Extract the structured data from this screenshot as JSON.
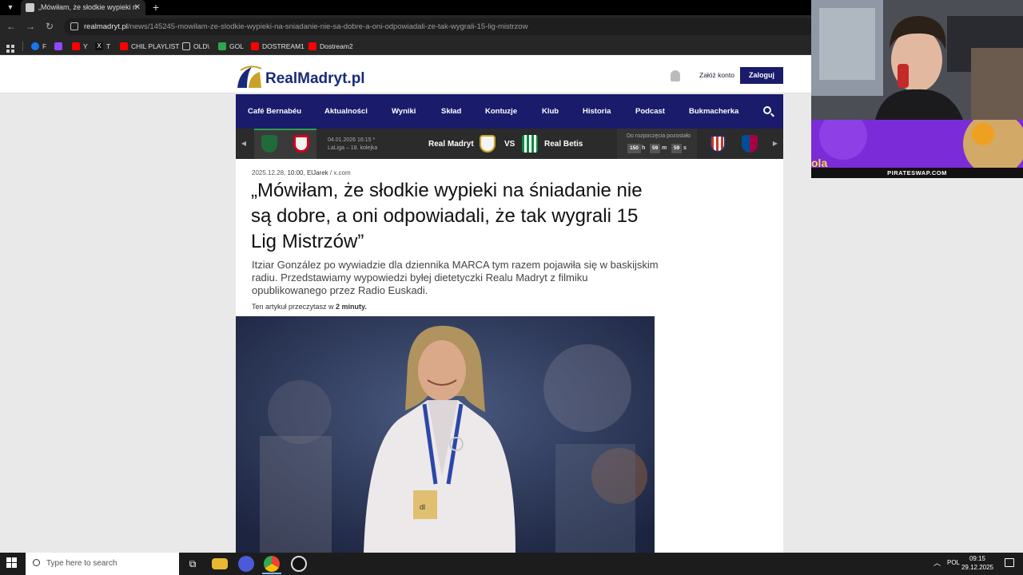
{
  "browser": {
    "tab_title": "„Mówiłam, że słodkie wypieki n",
    "tab_close": "✕",
    "new_tab": "+",
    "url_host": "realmadryt.pl",
    "url_path": "/news/145245-mowilam-ze-slodkie-wypieki-na-sniadanie-nie-sa-dobre-a-oni-odpowiadali-ze-tak-wygrali-15-lig-mistrzow",
    "bookmarks": [
      {
        "label": "F",
        "color": "#1877f2"
      },
      {
        "label": "",
        "color": "#9146ff"
      },
      {
        "label": "Y",
        "color": "#ff0000"
      },
      {
        "label": "T",
        "color": "#000000"
      },
      {
        "label": "CHIL PLAYLIST",
        "color": "#ff0000"
      },
      {
        "label": "OLD\\",
        "color": "#888888"
      },
      {
        "label": "GOL",
        "color": "#2aa84a"
      },
      {
        "label": "DOSTREAM1",
        "color": "#ff0000"
      },
      {
        "label": "Dostream2",
        "color": "#ff0000"
      }
    ]
  },
  "site": {
    "logo_main": "RealMadryt",
    "logo_tld": ".pl",
    "register_label": "Załóż konto",
    "login_label": "Zaloguj",
    "nav": [
      "Café Bernabéu",
      "Aktualności",
      "Wyniki",
      "Skład",
      "Kontuzje",
      "Klub",
      "Historia",
      "Podcast",
      "Bukmacherka"
    ]
  },
  "matchbar": {
    "prev_date": "04.01.2026 16:15 *",
    "prev_competition": "LaLiga – 18. kolejka",
    "home_team": "Real Madryt",
    "vs": "VS",
    "away_team": "Real Betis",
    "countdown_label": "Do rozpoczęcia pozostało",
    "countdown": {
      "hours": "150",
      "h": "h",
      "minutes": "59",
      "m": "m",
      "seconds": "59",
      "s": "s"
    }
  },
  "article": {
    "date": "2025.12.28, ",
    "time": "10:00",
    "sep": ", ",
    "author": "ElJarek",
    "source": " / x.com",
    "headline": "„Mówiłam, że słodkie wypieki na śniadanie nie są dobre, a oni odpowiadali, że tak wygrali 15 Lig Mistrzów”",
    "lead": "Itziar González po wywiadzie dla dziennika MARCA tym razem pojawiła się w baskijskim radiu. Przedstawiamy wypowiedzi byłej dietetyczki Realu Madryt z filmiku opublikowanego przez Radio Euskadi.",
    "read_prefix": "Ten artykuł przeczytasz w ",
    "read_time": "2 minuty."
  },
  "overlay": {
    "promo_text": "PIRATESWAP.COM",
    "promo_big": "ola"
  },
  "taskbar": {
    "search_placeholder": "Type here to search",
    "lang": "POL",
    "time": "09:15",
    "date": "29.12.2025"
  },
  "colors": {
    "brand_navy": "#1a1b6b",
    "accent_green": "#2e9e4a"
  }
}
